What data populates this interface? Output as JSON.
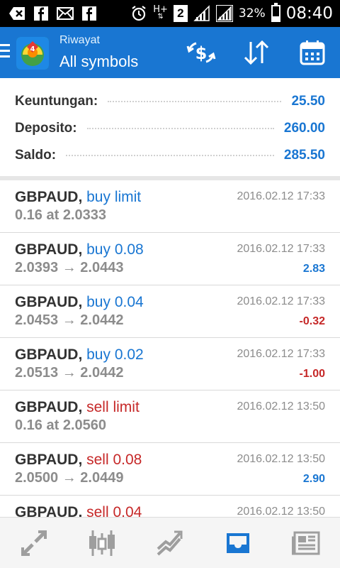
{
  "status_bar": {
    "battery_percent": "32%",
    "time": "08:40",
    "sim_badge": "2",
    "hplus": "H+"
  },
  "header": {
    "subtitle": "Riwayat",
    "title": "All symbols"
  },
  "summary": [
    {
      "label": "Keuntungan:",
      "value": "25.50"
    },
    {
      "label": "Deposito:",
      "value": "260.00"
    },
    {
      "label": "Saldo:",
      "value": "285.50"
    }
  ],
  "trades": [
    {
      "symbol": "GBPAUD,",
      "type": "buy limit",
      "side": "buy",
      "price": "0.16 at 2.0333",
      "time": "2016.02.12 17:33",
      "profit": ""
    },
    {
      "symbol": "GBPAUD,",
      "type": "buy 0.08",
      "side": "buy",
      "price": "2.0393 → 2.0443",
      "time": "2016.02.12 17:33",
      "profit": "2.83"
    },
    {
      "symbol": "GBPAUD,",
      "type": "buy 0.04",
      "side": "buy",
      "price": "2.0453 → 2.0442",
      "time": "2016.02.12 17:33",
      "profit": "-0.32"
    },
    {
      "symbol": "GBPAUD,",
      "type": "buy 0.02",
      "side": "buy",
      "price": "2.0513 → 2.0442",
      "time": "2016.02.12 17:33",
      "profit": "-1.00"
    },
    {
      "symbol": "GBPAUD,",
      "type": "sell limit",
      "side": "sell",
      "price": "0.16 at 2.0560",
      "time": "2016.02.12 13:50",
      "profit": ""
    },
    {
      "symbol": "GBPAUD,",
      "type": "sell 0.08",
      "side": "sell",
      "price": "2.0500 → 2.0449",
      "time": "2016.02.12 13:50",
      "profit": "2.90"
    },
    {
      "symbol": "GBPAUD,",
      "type": "sell 0.04",
      "side": "sell",
      "price": "",
      "time": "2016.02.12 13:50",
      "profit": ""
    }
  ],
  "colors": {
    "appbar": "#1976d2",
    "accent_blue": "#1976d2",
    "loss_red": "#c62828",
    "active_nav": "#1976d2",
    "inactive_nav": "#9e9e9e"
  },
  "icons": {
    "appbar_actions": [
      "currency-exchange-icon",
      "sort-icon",
      "calendar-icon"
    ],
    "bottom_nav": [
      "quotes-icon",
      "chart-icon",
      "trade-icon",
      "history-icon",
      "news-icon"
    ]
  }
}
